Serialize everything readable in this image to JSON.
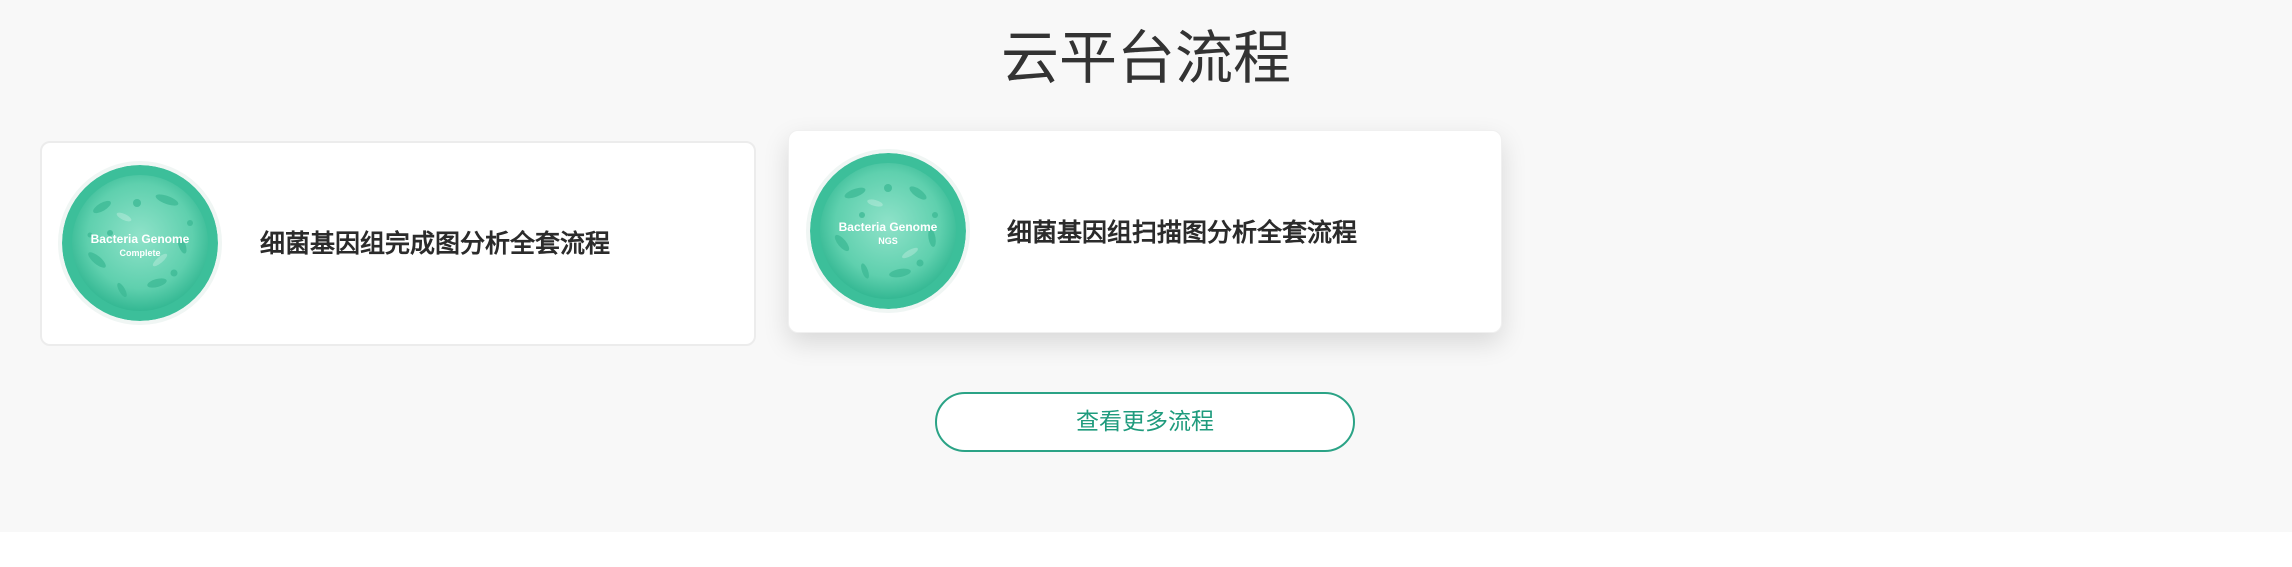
{
  "section": {
    "title": "云平台流程"
  },
  "cards": [
    {
      "label": "细菌基因组完成图分析全套流程",
      "thumb_title": "Bacteria Genome",
      "thumb_subtitle": "Complete",
      "icon": "bacteria-petri-dish-icon"
    },
    {
      "label": "细菌基因组扫描图分析全套流程",
      "thumb_title": "Bacteria Genome",
      "thumb_subtitle": "NGS",
      "icon": "bacteria-petri-dish-icon"
    }
  ],
  "more_button": {
    "label": "查看更多流程"
  },
  "colors": {
    "accent": "#1f9b7d",
    "petri_dark": "#2fb892",
    "petri_light": "#7edcc0",
    "background": "#f8f8f8"
  }
}
